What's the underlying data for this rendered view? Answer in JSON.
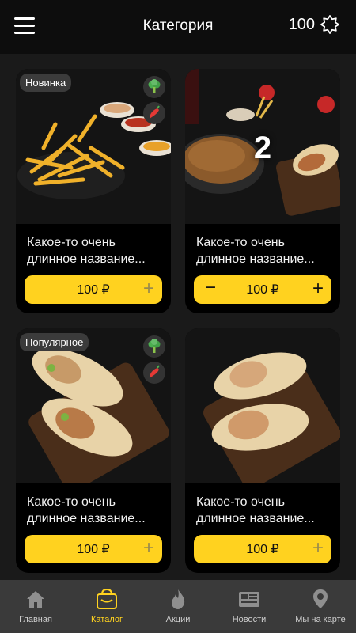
{
  "header": {
    "title": "Категория",
    "points": "100"
  },
  "products": [
    {
      "badge": "Новинка",
      "veg": true,
      "spicy": true,
      "name": "Какое-то очень длинное название...",
      "price": "100 ₽",
      "quantity": ""
    },
    {
      "badge": "",
      "veg": false,
      "spicy": false,
      "name": "Какое-то очень длинное название...",
      "price": "100 ₽",
      "quantity": "2",
      "minus": "−",
      "plus": "+"
    },
    {
      "badge": "Популярное",
      "veg": true,
      "spicy": true,
      "name": "Какое-то очень длинное название...",
      "price": "100 ₽",
      "quantity": ""
    },
    {
      "badge": "",
      "veg": false,
      "spicy": false,
      "name": "Какое-то очень длинное название...",
      "price": "100 ₽",
      "quantity": ""
    }
  ],
  "plus_symbol": "+",
  "tabbar": {
    "items": [
      {
        "label": "Главная",
        "icon": "home-icon"
      },
      {
        "label": "Каталог",
        "icon": "shopping-bag-icon",
        "active": true
      },
      {
        "label": "Акции",
        "icon": "flame-icon"
      },
      {
        "label": "Новости",
        "icon": "newspaper-icon"
      },
      {
        "label": "Мы на карте",
        "icon": "map-pin-icon"
      }
    ]
  },
  "colors": {
    "accent": "#ffd21f",
    "background": "#1a1a1a",
    "header": "#0d0d0d",
    "tabbar": "#3a3a3a",
    "card": "#000000"
  }
}
